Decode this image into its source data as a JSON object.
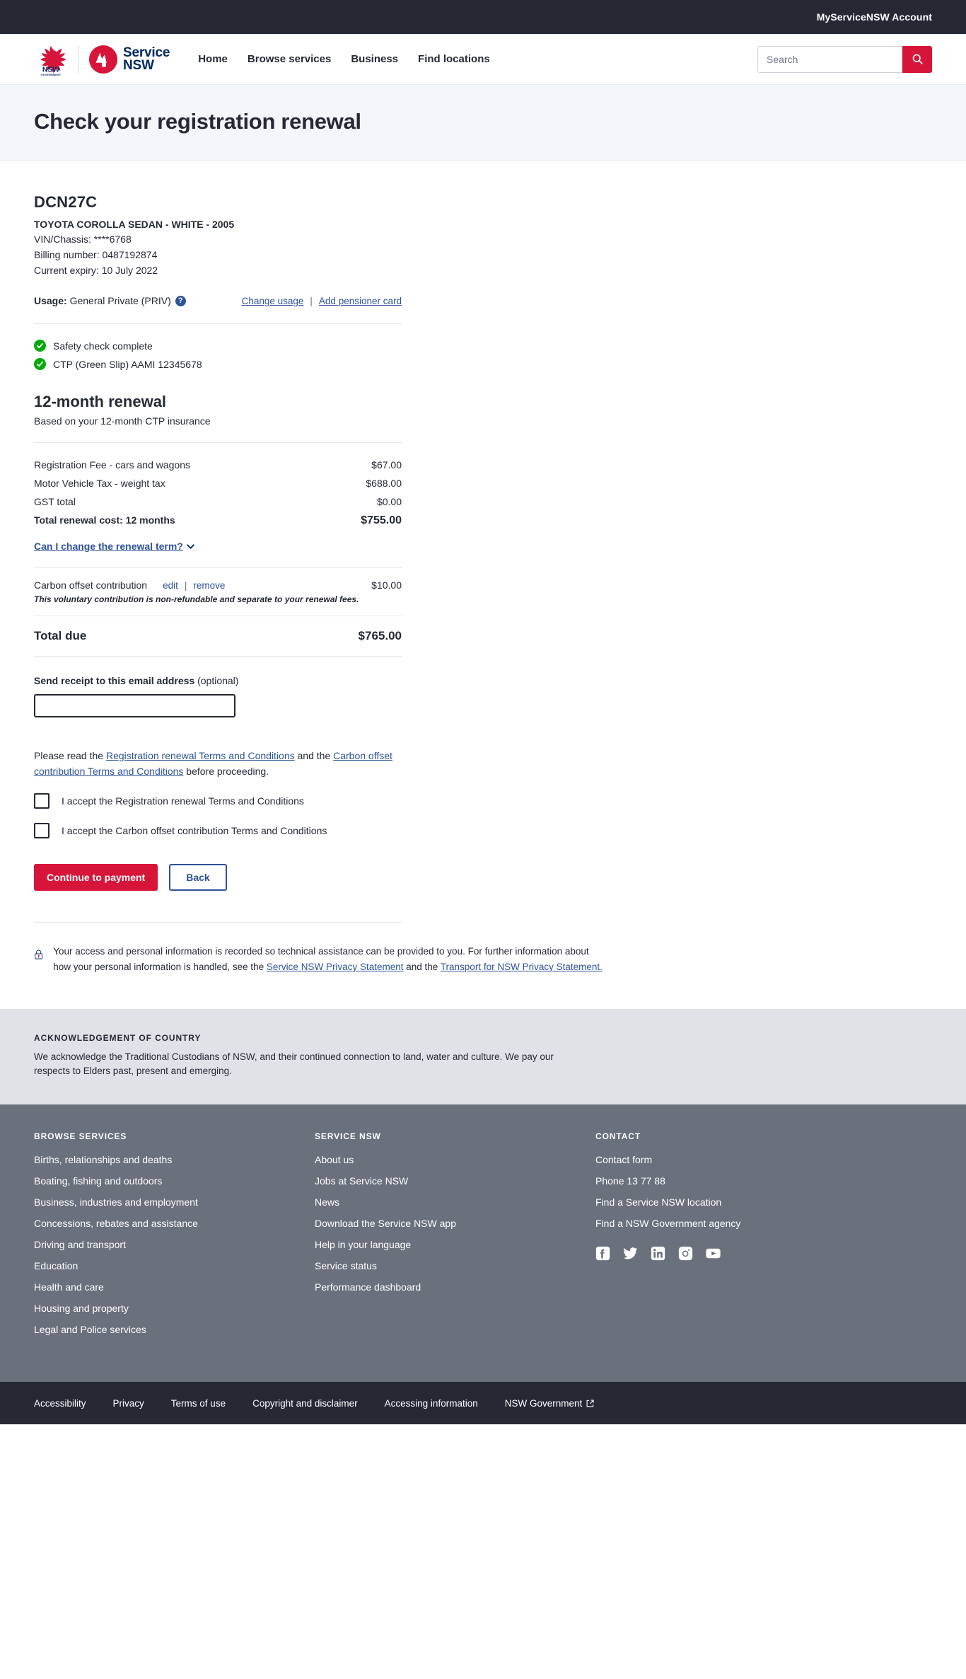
{
  "utility": {
    "account_link": "MyServiceNSW Account"
  },
  "header": {
    "nav": [
      {
        "label": "Home"
      },
      {
        "label": "Browse services"
      },
      {
        "label": "Business"
      },
      {
        "label": "Find locations"
      }
    ],
    "search": {
      "placeholder": "Search",
      "value": "",
      "icon": "search-icon"
    },
    "logo": {
      "nsw": "NSW",
      "nsw_sub": "GOVERNMENT",
      "service": "Service",
      "nsw_word": "NSW"
    }
  },
  "banner": {
    "title": "Check your registration renewal"
  },
  "vehicle": {
    "plate": "DCN27C",
    "description": "TOYOTA COROLLA SEDAN - WHITE - 2005",
    "vin": "VIN/Chassis: ****6768",
    "billing": "Billing number: 0487192874",
    "expiry": "Current expiry: 10 July 2022",
    "usage_label": "Usage:",
    "usage_value": "General Private (PRIV)",
    "help_icon": "?",
    "change_usage": "Change usage",
    "separator": "|",
    "add_pensioner": "Add pensioner card"
  },
  "checks": [
    {
      "label": "Safety check complete",
      "status": "complete"
    },
    {
      "label": "CTP (Green Slip) AAMI 12345678",
      "status": "complete"
    }
  ],
  "renewal": {
    "heading": "12-month renewal",
    "subheading": "Based on your 12-month CTP insurance",
    "fees": [
      {
        "label": "Registration Fee - cars and wagons",
        "amount": "$67.00"
      },
      {
        "label": "Motor Vehicle Tax - weight tax",
        "amount": "$688.00"
      },
      {
        "label": "GST total",
        "amount": "$0.00"
      }
    ],
    "total_label": "Total renewal cost: 12 months",
    "total_amount": "$755.00",
    "term_link": "Can I change the renewal term?"
  },
  "carbon_offset": {
    "label": "Carbon offset contribution",
    "edit": "edit",
    "separator": "|",
    "remove": "remove",
    "amount": "$10.00",
    "note": "This voluntary contribution is non-refundable and separate to your renewal fees."
  },
  "total_due": {
    "label": "Total due",
    "amount": "$765.00"
  },
  "email": {
    "label": "Send receipt to this email address",
    "optional": "(optional)",
    "value": "",
    "placeholder": ""
  },
  "terms": {
    "intro": "Please read the ",
    "link1": "Registration renewal Terms and Conditions",
    "middle": " and the ",
    "link2": "Carbon offset contribution Terms and Conditions",
    "outro": " before proceeding.",
    "checkbox1": "I accept the Registration renewal Terms and Conditions",
    "checkbox2": "I accept the Carbon offset contribution Terms and Conditions"
  },
  "actions": {
    "continue": "Continue to payment",
    "back": "Back"
  },
  "privacy": {
    "text1": "Your access and personal information is recorded so technical assistance can be provided to you. For further information about how your personal information is handled, see the ",
    "link1": "Service NSW Privacy Statement",
    "text2": " and the ",
    "link2": "Transport for NSW Privacy Statement.",
    "icon": "padlock-icon"
  },
  "acknowledgement": {
    "title": "ACKNOWLEDGEMENT OF COUNTRY",
    "text": "We acknowledge the Traditional Custodians of NSW, and their continued connection to land, water and culture. We pay our respects to Elders past, present and emerging."
  },
  "footer": {
    "columns": [
      {
        "heading": "BROWSE SERVICES",
        "links": [
          "Births, relationships and deaths",
          "Boating, fishing and outdoors",
          "Business, industries and employment",
          "Concessions, rebates and assistance",
          "Driving and transport",
          "Education",
          "Health and care",
          "Housing and property",
          "Legal and Police services"
        ]
      },
      {
        "heading": "SERVICE NSW",
        "links": [
          "About us",
          "Jobs at Service NSW",
          "News",
          "Download the Service NSW app",
          "Help in your language",
          "Service status",
          "Performance dashboard"
        ]
      },
      {
        "heading": "CONTACT",
        "links": [
          "Contact form",
          "Phone 13 77 88",
          "Find a Service NSW location",
          "Find a NSW Government agency"
        ]
      }
    ],
    "social": [
      {
        "name": "facebook-icon"
      },
      {
        "name": "twitter-icon"
      },
      {
        "name": "linkedin-icon"
      },
      {
        "name": "instagram-icon"
      },
      {
        "name": "youtube-icon"
      }
    ]
  },
  "bottom_bar": {
    "links": [
      {
        "label": "Accessibility",
        "external": false
      },
      {
        "label": "Privacy",
        "external": false
      },
      {
        "label": "Terms of use",
        "external": false
      },
      {
        "label": "Copyright and disclaimer",
        "external": false
      },
      {
        "label": "Accessing information",
        "external": false
      },
      {
        "label": "NSW Government",
        "external": true
      }
    ]
  },
  "colors": {
    "brand_red": "#d7153a",
    "brand_navy": "#002664",
    "link_blue": "#2e5299",
    "dark": "#242934",
    "success_green": "#00a908",
    "footer_grey": "#6a707c"
  }
}
